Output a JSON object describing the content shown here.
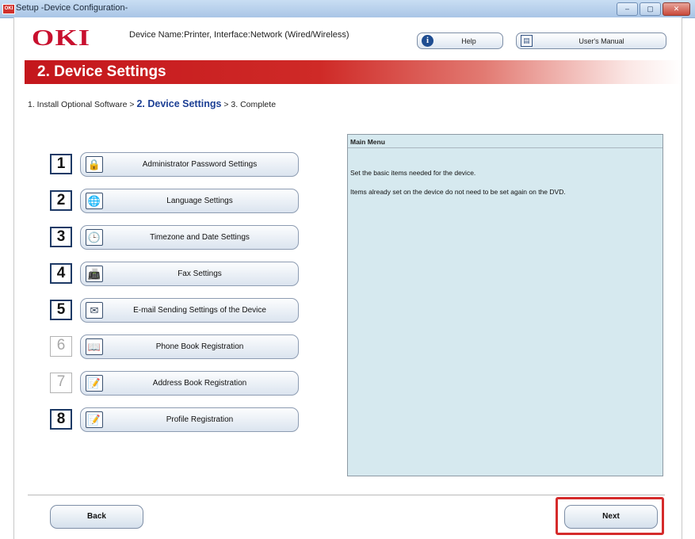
{
  "window": {
    "title": "Setup -Device Configuration-",
    "app_icon_text": "OKI",
    "minimize": "–",
    "maximize": "▢",
    "close": "✕"
  },
  "header": {
    "logo": "OKI",
    "device_name": "Device Name:Printer, Interface:Network (Wired/Wireless)",
    "help_label": "Help",
    "manual_label": "User's Manual"
  },
  "banner": {
    "title": "2. Device Settings"
  },
  "breadcrumb": {
    "step1": "1. Install Optional Software",
    "sep1": " > ",
    "step2": "2. Device Settings",
    "sep2": " > ",
    "step3": "3. Complete"
  },
  "menu": {
    "items": [
      {
        "number": "1",
        "label": "Administrator Password Settings",
        "icon": "key-card-icon",
        "glyph": "🔒"
      },
      {
        "number": "2",
        "label": "Language Settings",
        "icon": "language-icon",
        "glyph": "🌐"
      },
      {
        "number": "3",
        "label": "Timezone and Date Settings",
        "icon": "clock-icon",
        "glyph": "🕒"
      },
      {
        "number": "4",
        "label": "Fax Settings",
        "icon": "fax-icon",
        "glyph": "📠"
      },
      {
        "number": "5",
        "label": "E-mail Sending Settings of the Device",
        "icon": "email-icon",
        "glyph": "✉"
      },
      {
        "number": "6",
        "label": "Phone Book Registration",
        "icon": "phone-book-icon",
        "glyph": "📖"
      },
      {
        "number": "7",
        "label": "Address Book Registration",
        "icon": "address-book-icon",
        "glyph": "📝"
      },
      {
        "number": "8",
        "label": "Profile Registration",
        "icon": "profile-icon",
        "glyph": "📝"
      }
    ]
  },
  "panel": {
    "header": "Main Menu",
    "line1": "Set the basic items needed for the device.",
    "line2": "Items already set on the device do not need to be set again on the DVD."
  },
  "footer": {
    "back_label": "Back",
    "next_label": "Next"
  },
  "colors": {
    "brand_red": "#c8102e",
    "banner_red": "#c4161c",
    "highlight": "#d52b2b",
    "panel_bg": "#d6e9ef"
  }
}
